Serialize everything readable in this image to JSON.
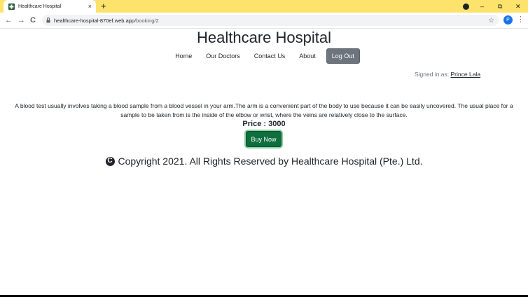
{
  "browser": {
    "tab_title": "Healthcare Hospital",
    "tab_close": "×",
    "new_tab": "+",
    "url_host": "healthcare-hospital-870ef.web.app",
    "url_path": "/booking/2",
    "profile_initial": "P",
    "minimize": "–",
    "restore": "⧉",
    "close": "✕",
    "back": "←",
    "forward": "→",
    "reload": "C",
    "star": "☆",
    "menu": "⋮"
  },
  "site": {
    "title": "Healthcare Hospital",
    "nav": [
      "Home",
      "Our Doctors",
      "Contact Us",
      "About"
    ],
    "logout_label": "Log Out",
    "signed_in_prefix": "Signed in as: ",
    "signed_in_user": "Prince Lala"
  },
  "service": {
    "description": "A blood test usually involves taking a blood sample from a blood vessel in your arm.The arm is a convenient part of the body to use because it can be easily uncovered. The usual place for a sample to be taken from is the inside of the elbow or wrist, where the veins are relatively close to the surface.",
    "price_label": "Price : 3000",
    "buy_label": "Buy Now"
  },
  "footer": {
    "copyright_symbol": "C",
    "copyright": "Copyright 2021. All Rights Reserved by Healthcare Hospital (Pte.) Ltd."
  },
  "colors": {
    "tabstrip": "#fde26b",
    "logout_button": "#6c757d",
    "buy_button": "#0f6e3e",
    "avatar": "#1a73e8"
  }
}
